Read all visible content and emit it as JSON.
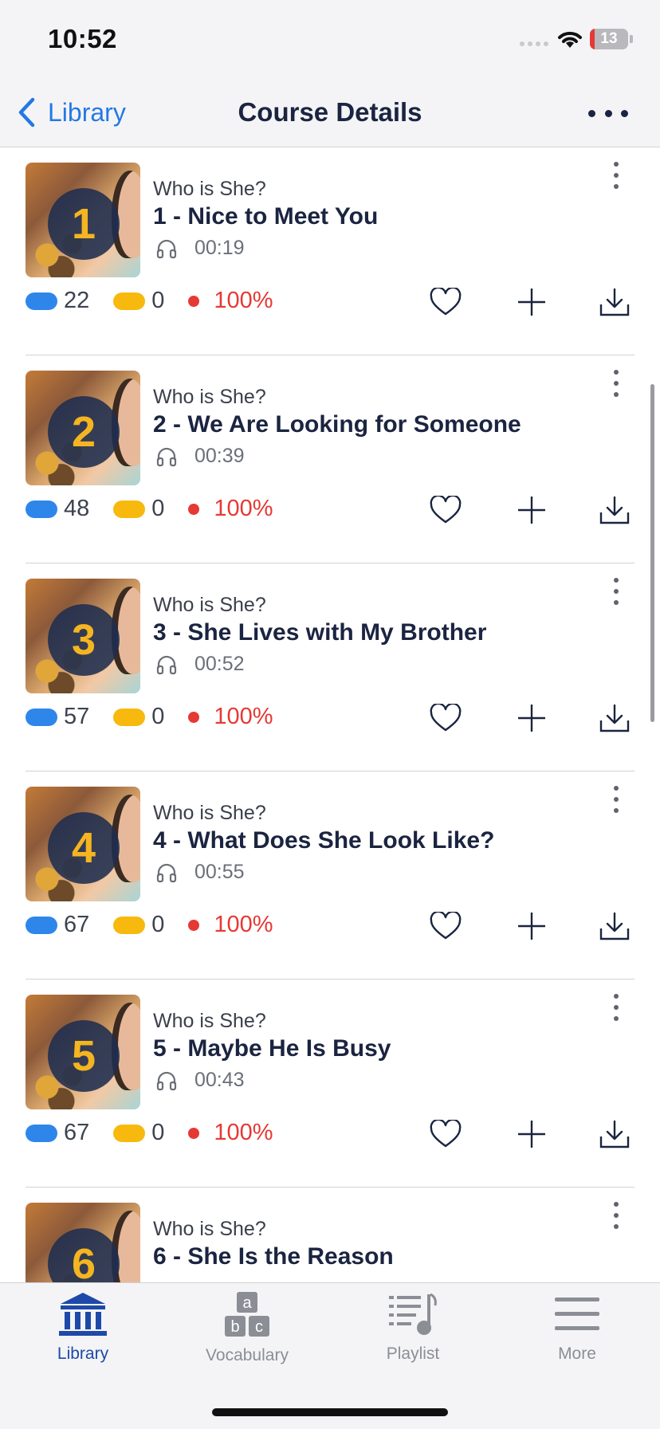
{
  "status_bar": {
    "time": "10:52",
    "battery": "13",
    "battery_level": 0.13
  },
  "nav": {
    "back_label": "Library",
    "title": "Course Details"
  },
  "lessons": [
    {
      "number": "1",
      "course": "Who is She?",
      "title": "1 - Nice to Meet You",
      "duration": "00:19",
      "blue_count": "22",
      "yellow_count": "0",
      "progress": "100%"
    },
    {
      "number": "2",
      "course": "Who is She?",
      "title": "2 - We Are Looking for Someone",
      "duration": "00:39",
      "blue_count": "48",
      "yellow_count": "0",
      "progress": "100%"
    },
    {
      "number": "3",
      "course": "Who is She?",
      "title": "3 - She Lives with My Brother",
      "duration": "00:52",
      "blue_count": "57",
      "yellow_count": "0",
      "progress": "100%"
    },
    {
      "number": "4",
      "course": "Who is She?",
      "title": "4 - What Does She Look Like?",
      "duration": "00:55",
      "blue_count": "67",
      "yellow_count": "0",
      "progress": "100%"
    },
    {
      "number": "5",
      "course": "Who is She?",
      "title": "5 - Maybe He Is Busy",
      "duration": "00:43",
      "blue_count": "67",
      "yellow_count": "0",
      "progress": "100%"
    },
    {
      "number": "6",
      "course": "Who is She?",
      "title": "6 - She Is the Reason",
      "duration": "",
      "blue_count": "",
      "yellow_count": "",
      "progress": ""
    }
  ],
  "tabs": [
    {
      "label": "Library",
      "icon": "library-icon",
      "active": true
    },
    {
      "label": "Vocabulary",
      "icon": "vocabulary-icon",
      "active": false
    },
    {
      "label": "Playlist",
      "icon": "playlist-icon",
      "active": false
    },
    {
      "label": "More",
      "icon": "menu-icon",
      "active": false
    }
  ],
  "colors": {
    "accent": "#2478e5",
    "navy": "#1b2440",
    "blue_pill": "#2f86ea",
    "yellow_pill": "#f8b90e",
    "progress_red": "#e53935",
    "active_tab": "#1d4aa8"
  }
}
